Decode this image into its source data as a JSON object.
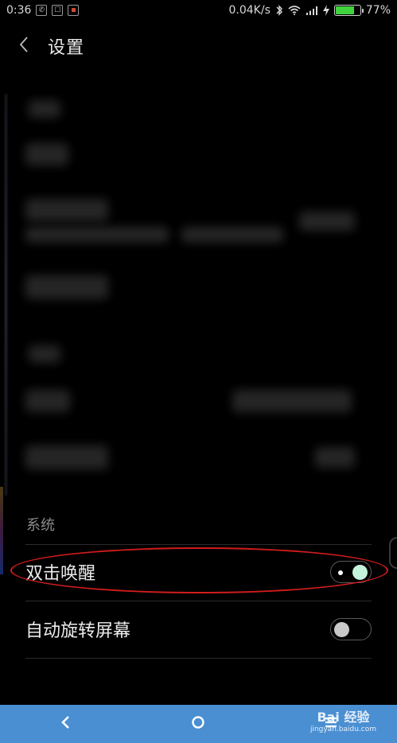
{
  "status_bar": {
    "time": "0:36",
    "network_speed": "0.04K/s",
    "battery_percent": "77%",
    "battery_level": 0.77,
    "icons": [
      "notification-icon",
      "notification-icon",
      "notification-icon",
      "bluetooth-icon",
      "wifi-icon",
      "signal-icon",
      "charging-icon",
      "battery-icon"
    ]
  },
  "header": {
    "title": "设置"
  },
  "system_section": {
    "header": "系统",
    "items": [
      {
        "label": "双击唤醒",
        "enabled": true
      },
      {
        "label": "自动旋转屏幕",
        "enabled": false
      }
    ]
  },
  "nav_bar": {
    "buttons": [
      "back-icon",
      "home-icon",
      "menu-icon"
    ]
  },
  "watermark": {
    "main": "Bai 经验",
    "sub": "jingyan.baidu.com"
  },
  "colors": {
    "background": "#000000",
    "nav_bar": "#4a8fd2",
    "toggle_on_knob": "#c6f5dd",
    "highlight": "#d21c1c",
    "battery_fill": "#41d23e"
  }
}
